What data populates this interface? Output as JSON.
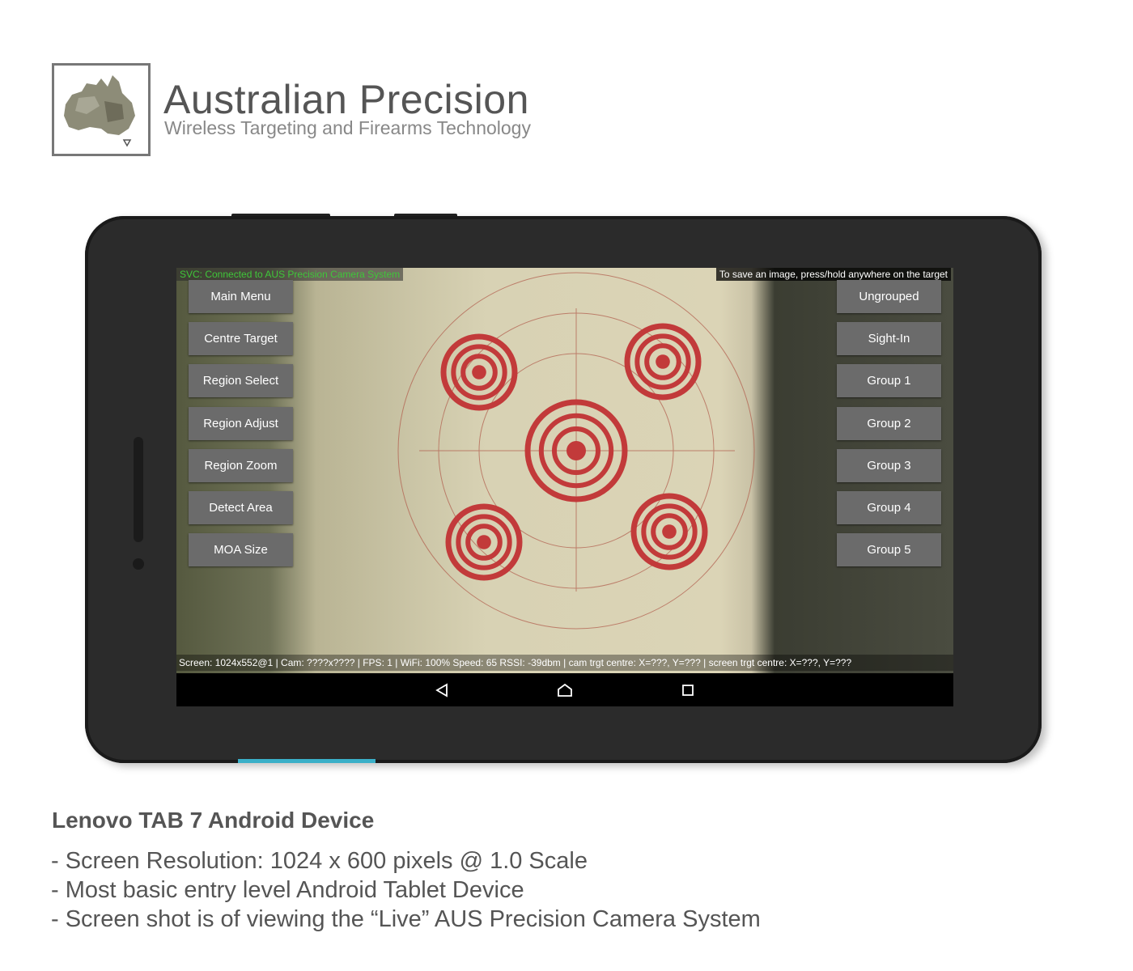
{
  "brand": {
    "title": "Australian Precision",
    "subtitle": "Wireless Targeting and Firearms Technology"
  },
  "screen": {
    "status_top": "SVC: Connected to AUS Precision Camera System",
    "hint_top": "To save an image, press/hold anywhere on the target",
    "status_bottom": "Screen: 1024x552@1 | Cam: ????x???? | FPS: 1 | WiFi: 100% Speed: 65 RSSI: -39dbm | cam trgt centre: X=???, Y=??? | screen trgt centre: X=???, Y=???",
    "left_buttons": [
      "Main Menu",
      "Centre Target",
      "Region Select",
      "Region Adjust",
      "Region Zoom",
      "Detect Area",
      "MOA Size"
    ],
    "right_buttons": [
      "Ungrouped",
      "Sight-In",
      "Group 1",
      "Group 2",
      "Group 3",
      "Group 4",
      "Group 5"
    ],
    "nav": [
      "back-icon",
      "home-icon",
      "recents-icon"
    ],
    "colors": {
      "status_green": "#3fc63a",
      "button_bg": "#6b6b6b",
      "target_red": "#c23a3a"
    }
  },
  "device": {
    "title": "Lenovo TAB 7 Android Device",
    "bullets": [
      "- Screen Resolution: 1024 x 600 pixels @ 1.0 Scale",
      "- Most basic entry level Android Tablet Device",
      "- Screen shot is of viewing the “Live” AUS Precision Camera System"
    ]
  }
}
